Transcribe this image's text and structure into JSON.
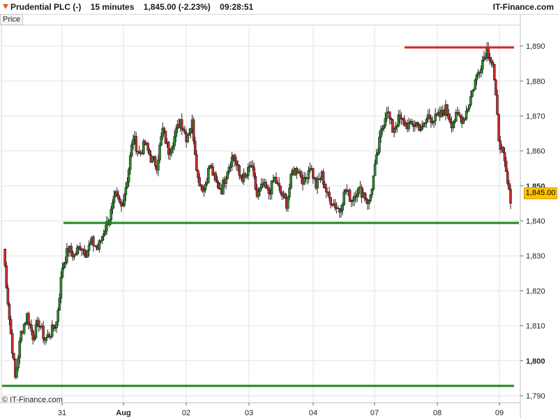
{
  "header": {
    "instrument": "Prudential PLC (-)",
    "interval": "15 minutes",
    "quote": "1,845.00 (-2.23%)",
    "time": "09:28:51",
    "brand": "IT-Finance.com",
    "icon": "triangle-down-icon"
  },
  "panel_tab": "Price",
  "copyright": "© IT-Finance.com",
  "last_price_label": "1,845.00",
  "colors": {
    "up_candle": "#2e8b2e",
    "down_candle": "#cc2b2b",
    "support_line": "#1a8a1a",
    "resistance_line": "#e02020",
    "price_badge": "#ffc400"
  },
  "chart_data": {
    "type": "line",
    "series": [
      {
        "values": [
          1832,
          1812,
          1795,
          1808,
          1813,
          1807,
          1811,
          1806,
          1808,
          1811,
          1827,
          1832,
          1830,
          1833,
          1831,
          1834,
          1832,
          1837,
          1841,
          1847,
          1844,
          1852,
          1864,
          1859,
          1862,
          1858,
          1856,
          1866,
          1860,
          1864,
          1869,
          1864,
          1868,
          1852,
          1849,
          1856,
          1851,
          1849,
          1855,
          1859,
          1853,
          1852,
          1856,
          1847,
          1850,
          1848,
          1852,
          1848,
          1845,
          1854,
          1855,
          1851,
          1856,
          1850,
          1853,
          1847,
          1845,
          1843,
          1849,
          1846,
          1849,
          1848,
          1845,
          1855,
          1865,
          1872,
          1866,
          1869,
          1868,
          1867,
          1868,
          1866,
          1870,
          1869,
          1870,
          1872,
          1868,
          1870,
          1869,
          1874,
          1880,
          1885,
          1889,
          1885,
          1864,
          1856,
          1845
        ]
      }
    ],
    "y_ticks": [
      "1,790",
      "1,800",
      "1,810",
      "1,820",
      "1,830",
      "1,840",
      "1,850",
      "1,860",
      "1,870",
      "1,880",
      "1,890"
    ],
    "y_tick_values": [
      1790,
      1800,
      1810,
      1820,
      1830,
      1840,
      1850,
      1860,
      1870,
      1880,
      1890
    ],
    "bold_y_ticks": [
      "1,800",
      "1,850"
    ],
    "x_labels": [
      "31",
      "Aug",
      "02",
      "03",
      "04",
      "07",
      "08",
      "09"
    ],
    "bold_x_labels": [
      "Aug"
    ],
    "ylim": [
      1788,
      1896
    ],
    "horizontal_lines": [
      {
        "value": 1839.4,
        "color": "support"
      },
      {
        "value": 1792.8,
        "color": "support"
      },
      {
        "value": 1889.6,
        "color": "resistance"
      }
    ],
    "grid": true
  }
}
